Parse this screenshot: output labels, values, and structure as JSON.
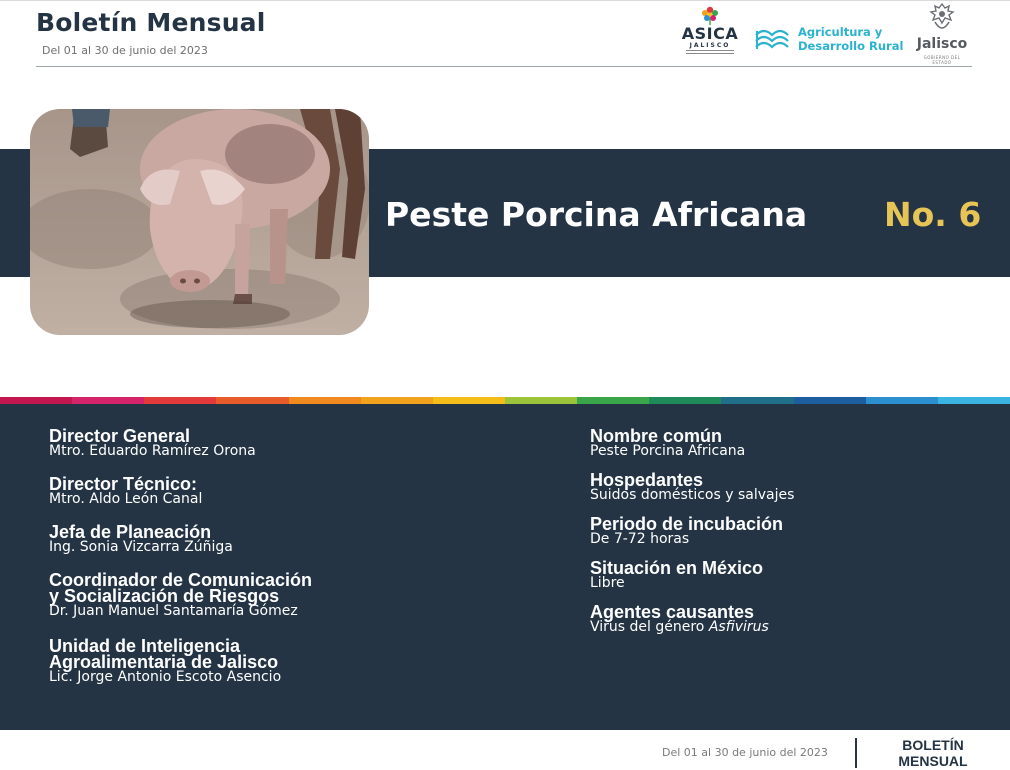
{
  "header": {
    "title": "Boletín Mensual",
    "date_range": "Del 01 al 30 de junio del 2023"
  },
  "logos": {
    "asica": {
      "name": "ASICA",
      "subtitle": "JALISCO"
    },
    "agricultura": {
      "line1": "Agricultura y",
      "line2": "Desarrollo Rural"
    },
    "jalisco": {
      "name": "Jalisco",
      "subtitle": "GOBIERNO DEL ESTADO"
    }
  },
  "banner": {
    "title": "Peste Porcina Africana",
    "number": "No. 6"
  },
  "colors": {
    "navy": "#243444",
    "gold": "#e7c456",
    "agri_blue": "#2ab2cf",
    "stripe": [
      "#c4174f",
      "#d6246a",
      "#e23a3a",
      "#e85b2a",
      "#f08a1e",
      "#f2a21c",
      "#f4bd1a",
      "#9cc43a",
      "#3aa64a",
      "#1f8a5a",
      "#1f6f8a",
      "#1d5f9e",
      "#2b8fd0",
      "#3ab3e0"
    ]
  },
  "staff": [
    {
      "label": "Director General",
      "value": "Mtro. Eduardo Ramírez Orona"
    },
    {
      "label": "Director Técnico:",
      "value": "Mtro. Aldo León Canal"
    },
    {
      "label": "Jefa de Planeación",
      "value": "Ing. Sonia Vizcarra Zúñiga"
    },
    {
      "label_line1": "Coordinador de Comunicación",
      "label_line2": "y Socialización de Riesgos",
      "value": "Dr. Juan Manuel Santamaría Gómez"
    },
    {
      "label_line1": "Unidad de Inteligencia",
      "label_line2": "Agroalimentaria de Jalisco",
      "value": "Lic. Jorge Antonio Escoto Asencio"
    }
  ],
  "disease": [
    {
      "label": "Nombre común",
      "value": "Peste Porcina Africana"
    },
    {
      "label": "Hospedantes",
      "value": "Suidos domésticos y salvajes"
    },
    {
      "label": "Periodo de incubación",
      "value": "De 7-72 horas"
    },
    {
      "label": "Situación en México",
      "value": "Libre"
    },
    {
      "label": "Agentes causantes",
      "value_prefix": "Virus del género ",
      "value_italic": "Asfivirus"
    }
  ],
  "footer": {
    "date_range": "Del 01 al 30 de junio del 2023",
    "brand_line1": "BOLETÍN",
    "brand_line2": "MENSUAL"
  }
}
